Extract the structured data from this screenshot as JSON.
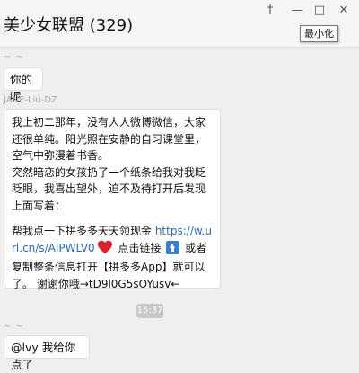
{
  "window": {
    "title": "美少女联盟 (329)",
    "pin_glyph": "†",
    "minimize_glyph": "—",
    "maximize_glyph": "□",
    "close_glyph": "✕",
    "tooltip": "最小化"
  },
  "messages": [
    {
      "sender": "~ ~",
      "text": "你的呢"
    },
    {
      "sender": "JANE-Liu-DZ",
      "paragraphs": [
        "我上初二那年，没有人人微博微信，大家还很单纯。阳光照在安静的自习课堂里，空气中弥漫着书香。",
        "突然暗恋的女孩扔了一个纸条给我对我眨眨眼，我喜出望外，迫不及待打开后发现上面写着："
      ],
      "share_prefix": "帮我点一下拼多多天天领现金 ",
      "share_link": "https://w.url.cn/s/AIPWLV0",
      "click_link_text": " 点击链接 ",
      "copy_text": " 或者复制整条信息打开【拼多多App】就可以了。 谢谢你哦→tD9l0G5sOYusv←",
      "heart_icon": "red-heart",
      "up_icon": "blue-up-arrow"
    },
    {
      "sender": "~ ~",
      "text": "@lvy 我给你点了"
    }
  ],
  "timestamp": "15:37",
  "colors": {
    "link": "#2a6ac0",
    "heart": "#e0202c",
    "up_icon_bg": "#3a7dd0"
  }
}
